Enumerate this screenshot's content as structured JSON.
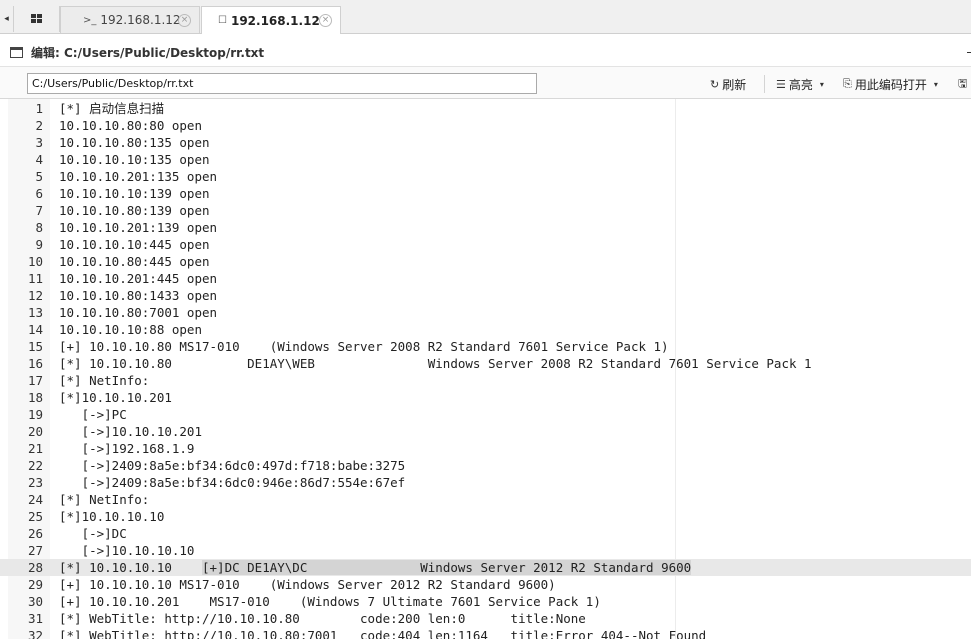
{
  "tabs": {
    "scroll_glyph": "◂",
    "items": [
      {
        "icon": ">_",
        "label": "192.168.1.12",
        "close": "×"
      },
      {
        "icon": "☐",
        "label": "192.168.1.12",
        "close": "×"
      }
    ]
  },
  "window": {
    "title": "编辑: C:/Users/Public/Desktop/rr.txt"
  },
  "toolbar": {
    "path_value": "C:/Users/Public/Desktop/rr.txt",
    "refresh_icon": "↻",
    "refresh_label": "刷新",
    "highlight_icon": "☰",
    "highlight_label": "高亮",
    "open_icon": "⎘",
    "open_label": "用此编码打开",
    "save_icon": "🖫",
    "caret": "▾"
  },
  "editor": {
    "active_line": 28,
    "lines": [
      {
        "n": "1",
        "text": "[*] 启动信息扫描"
      },
      {
        "n": "2",
        "text": "10.10.10.80:80 open"
      },
      {
        "n": "3",
        "text": "10.10.10.80:135 open"
      },
      {
        "n": "4",
        "text": "10.10.10.10:135 open"
      },
      {
        "n": "5",
        "text": "10.10.10.201:135 open"
      },
      {
        "n": "6",
        "text": "10.10.10.10:139 open"
      },
      {
        "n": "7",
        "text": "10.10.10.80:139 open"
      },
      {
        "n": "8",
        "text": "10.10.10.201:139 open"
      },
      {
        "n": "9",
        "text": "10.10.10.10:445 open"
      },
      {
        "n": "10",
        "text": "10.10.10.80:445 open"
      },
      {
        "n": "11",
        "text": "10.10.10.201:445 open"
      },
      {
        "n": "12",
        "text": "10.10.10.80:1433 open"
      },
      {
        "n": "13",
        "text": "10.10.10.80:7001 open"
      },
      {
        "n": "14",
        "text": "10.10.10.10:88 open"
      },
      {
        "n": "15",
        "text": "[+] 10.10.10.80 MS17-010    (Windows Server 2008 R2 Standard 7601 Service Pack 1)"
      },
      {
        "n": "16",
        "text": "[*] 10.10.10.80          DE1AY\\WEB               Windows Server 2008 R2 Standard 7601 Service Pack 1"
      },
      {
        "n": "17",
        "text": "[*] NetInfo:"
      },
      {
        "n": "18",
        "text": "[*]10.10.10.201"
      },
      {
        "n": "19",
        "text": "   [->]PC"
      },
      {
        "n": "20",
        "text": "   [->]10.10.10.201"
      },
      {
        "n": "21",
        "text": "   [->]192.168.1.9"
      },
      {
        "n": "22",
        "text": "   [->]2409:8a5e:bf34:6dc0:497d:f718:babe:3275"
      },
      {
        "n": "23",
        "text": "   [->]2409:8a5e:bf34:6dc0:946e:86d7:554e:67ef"
      },
      {
        "n": "24",
        "text": "[*] NetInfo:"
      },
      {
        "n": "25",
        "text": "[*]10.10.10.10"
      },
      {
        "n": "26",
        "text": "   [->]DC"
      },
      {
        "n": "27",
        "text": "   [->]10.10.10.10"
      },
      {
        "n": "28",
        "text_before": "[*] 10.10.10.10    ",
        "text_selected": "[+]DC DE1AY\\DC               Windows Server 2012 R2 Standard 9600"
      },
      {
        "n": "29",
        "text": "[+] 10.10.10.10 MS17-010    (Windows Server 2012 R2 Standard 9600)"
      },
      {
        "n": "30",
        "text": "[+] 10.10.10.201    MS17-010    (Windows 7 Ultimate 7601 Service Pack 1)"
      },
      {
        "n": "31",
        "text": "[*] WebTitle: http://10.10.10.80        code:200 len:0      title:None"
      },
      {
        "n": "32",
        "text": "[*] WebTitle: http://10.10.10.80:7001   code:404 len:1164   title:Error 404--Not Found"
      }
    ]
  }
}
